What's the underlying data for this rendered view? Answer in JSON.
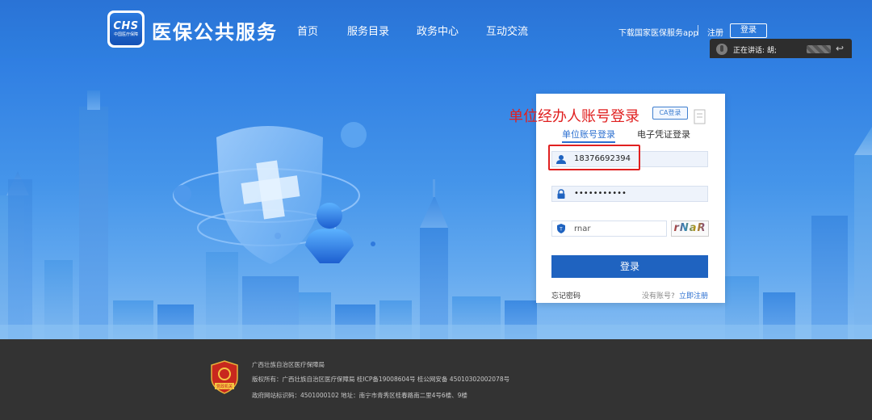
{
  "header": {
    "logo_text": "CHS",
    "logo_subtext": "中国医疗保障",
    "title": "医保公共服务",
    "nav": [
      "首页",
      "服务目录",
      "政务中心",
      "互动交流"
    ],
    "download_app": "下载国家医保服务app",
    "register": "注册",
    "login": "登录"
  },
  "toast": {
    "speaking": "正在讲话: 胡;"
  },
  "login_card": {
    "annotation": "单位经办人账号登录",
    "ca_tag": "CA登录",
    "tabs": [
      "单位账号登录",
      "电子凭证登录"
    ],
    "username_value": "18376692394",
    "password_value": "•••••••••••",
    "captcha_value": "rnar",
    "captcha_image_text": "rNaR",
    "submit": "登录",
    "forgot_password": "忘记密码",
    "no_account": "没有账号?",
    "register_now": "立即注册"
  },
  "footer": {
    "org": "广西壮族自治区医疗保障局",
    "copyright": "版权所有：广西壮族自治区医疗保障局 桂ICP备19008604号 桂公网安备 45010302002078号",
    "site_id": "政府网站标识码：4501000102   地址：南宁市青秀区桂春路南二里4号6楼、9楼",
    "emblem_label": "党政机关"
  },
  "colors": {
    "header_blue": "#2a73d6",
    "primary_button": "#1f63c0",
    "annotation_red": "#e02020",
    "footer_bg": "#333333"
  }
}
